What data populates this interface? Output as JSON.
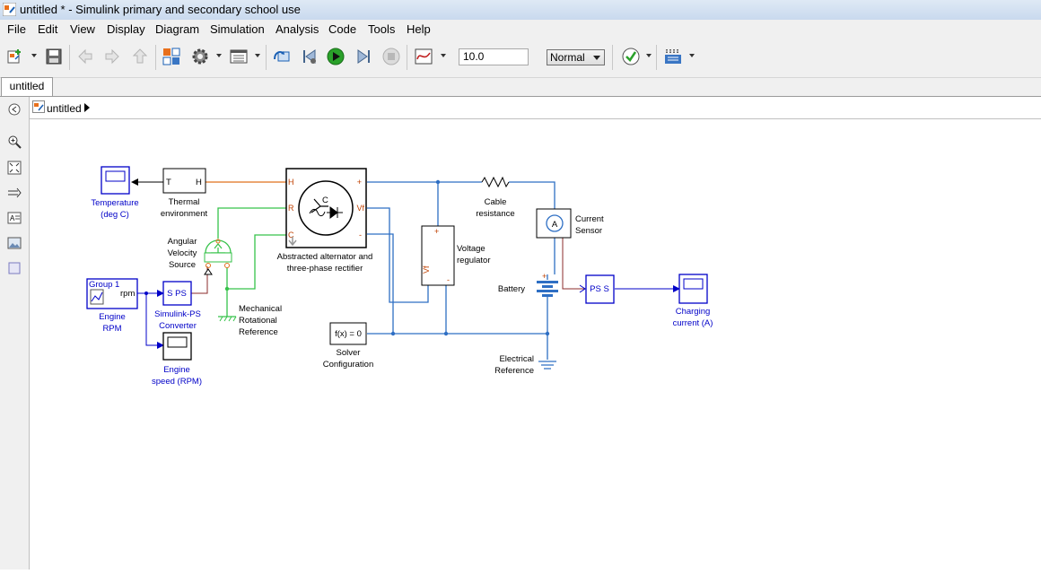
{
  "window": {
    "title": "untitled * - Simulink primary and secondary school use"
  },
  "menu": [
    "File",
    "Edit",
    "View",
    "Display",
    "Diagram",
    "Simulation",
    "Analysis",
    "Code",
    "Tools",
    "Help"
  ],
  "toolbar": {
    "stop_time": "10.0",
    "sim_mode": "Normal"
  },
  "tab": {
    "label": "untitled"
  },
  "breadcrumb": {
    "model": "untitled"
  },
  "blocks": {
    "temperature_scope": [
      "Temperature",
      "(deg C)"
    ],
    "thermal_env": [
      "Thermal",
      "environment"
    ],
    "thermal_ports": [
      "T",
      "H"
    ],
    "alternator": [
      "Abstracted alternator and",
      "three-phase rectifier"
    ],
    "alternator_ports_left": [
      "H",
      "R",
      "C"
    ],
    "alternator_ports_right": [
      "+",
      "Vf",
      "-"
    ],
    "alternator_c": "C",
    "cable": [
      "Cable",
      "resistance"
    ],
    "current_sensor": [
      "Current",
      "Sensor"
    ],
    "voltage_regulator": [
      "Voltage",
      "regulator"
    ],
    "battery": "Battery",
    "angular_source": [
      "Angular",
      "Velocity",
      "Source"
    ],
    "mech_ref": [
      "Mechanical",
      "Rotational",
      "Reference"
    ],
    "engine_rpm_group": "Group 1",
    "engine_rpm_unit": "rpm",
    "engine_rpm": [
      "Engine",
      "RPM"
    ],
    "sps": "S PS",
    "sps_label": [
      "Simulink-PS",
      "Converter"
    ],
    "engine_speed": [
      "Engine",
      "speed (RPM)"
    ],
    "solver": "f(x) = 0",
    "solver_label": [
      "Solver",
      "Configuration"
    ],
    "electrical_ref": [
      "Electrical",
      "Reference"
    ],
    "pss": "PS  S",
    "charging_scope": [
      "Charging",
      "current (A)"
    ]
  },
  "colors": {
    "electrical": "#2e6fc4",
    "mechanical": "#36c24a",
    "thermal": "#e0701c",
    "signal": "#0000c8",
    "ps_signal": "#8b2b2b"
  }
}
